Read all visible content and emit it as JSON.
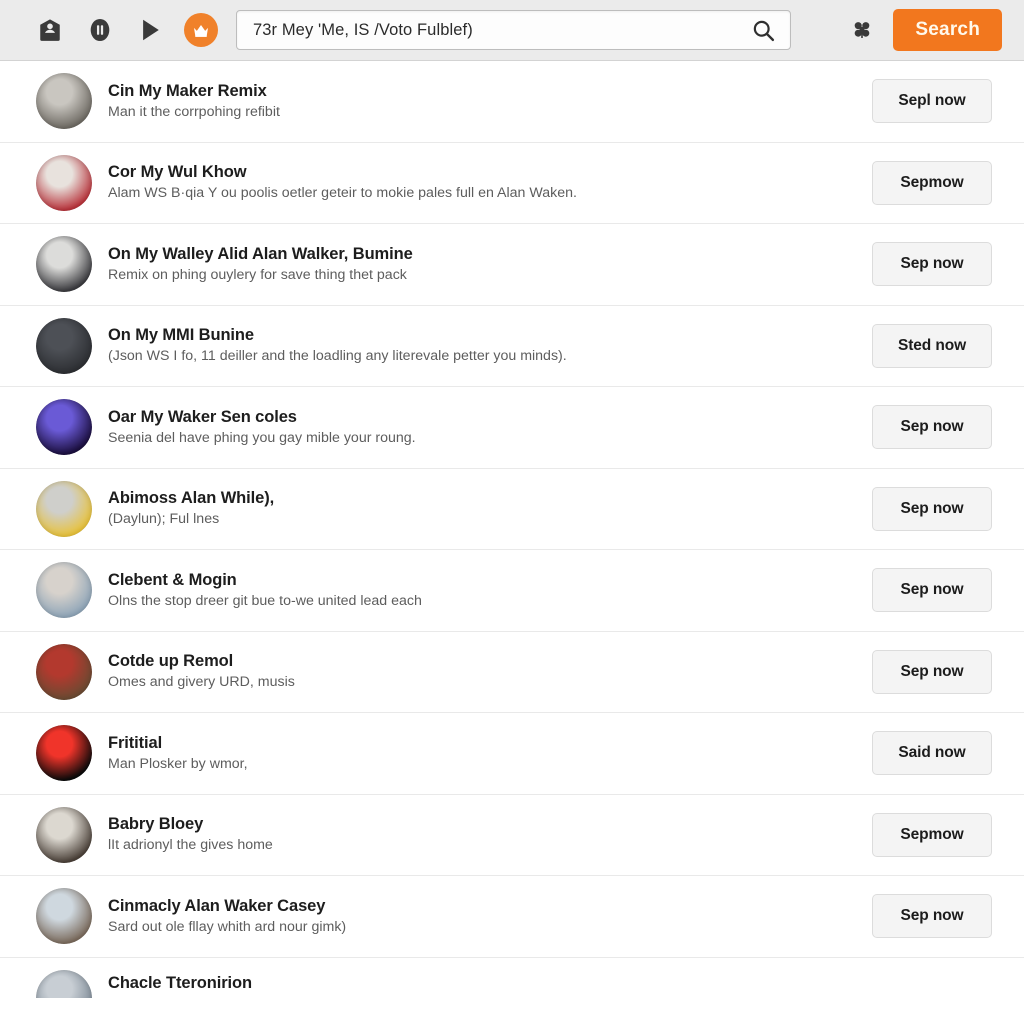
{
  "toolbar": {
    "icons": [
      {
        "name": "inbox-person-icon",
        "glyph": "inbox"
      },
      {
        "name": "pause-circle-icon",
        "glyph": "pause"
      },
      {
        "name": "play-icon",
        "glyph": "play"
      },
      {
        "name": "crown-badge-icon",
        "glyph": "crown"
      }
    ],
    "crown_badge_color": "#f0812a",
    "search": {
      "value": "73r Mey 'Me, IS /Voto Fulblef)",
      "placeholder": "73r Mey 'Me, IS /Voto Fulblef)",
      "icon": "search-icon"
    },
    "clover_icon": "clover-icon",
    "search_button_label": "Search",
    "search_button_color": "#f2771e",
    "background_color": "#ebebeb"
  },
  "list": {
    "rows": [
      {
        "title": "Cin My Maker Remix",
        "subtitle": "Man it the corrpohing refibit",
        "action": "Sepl now",
        "avatar_color_a": "#6e6a63",
        "avatar_color_b": "#c9c6c0"
      },
      {
        "title": "Cor My Wul Khow",
        "subtitle": "Alam WS B·qia Y ou poolis oetler geteir to mokie pales full en Alan Waken.",
        "action": "Sepmow",
        "avatar_color_a": "#b8333b",
        "avatar_color_b": "#e8e2dd"
      },
      {
        "title": "On My Walley Alid Alan Walker, Bumine",
        "subtitle": "Remix on phing ouylery for save thing thet pack",
        "action": "Sep now",
        "avatar_color_a": "#3a3a3e",
        "avatar_color_b": "#dcdcda"
      },
      {
        "title": "On My MMI Bunine",
        "subtitle": "(Json WS I fo, 11 deiller and the loadling any literevale petter you minds).",
        "action": "Sted now",
        "avatar_color_a": "#2d2f33",
        "avatar_color_b": "#4d5056"
      },
      {
        "title": "Oar My Waker Sen coles",
        "subtitle": "Seenia del have phing you gay mible your roung.",
        "action": "Sep now",
        "avatar_color_a": "#1b0f3e",
        "avatar_color_b": "#6a5ad6"
      },
      {
        "title": "Abimoss Alan While),",
        "subtitle": "(Daylun); Ful lnes",
        "action": "Sep now",
        "avatar_color_a": "#e8c23a",
        "avatar_color_b": "#cfcfcb"
      },
      {
        "title": "Clebent & Mogin",
        "subtitle": "Olns the stop dreer git bue to-we united lead each",
        "action": "Sep now",
        "avatar_color_a": "#8fa5b8",
        "avatar_color_b": "#d7d2cc"
      },
      {
        "title": "Cotde up Remol",
        "subtitle": "Omes and givery URD, musis",
        "action": "Sep now",
        "avatar_color_a": "#6b4a32",
        "avatar_color_b": "#b3392e"
      },
      {
        "title": "Frititial",
        "subtitle": "Man Plosker by wmor,",
        "action": "Said now",
        "avatar_color_a": "#0a0a0a",
        "avatar_color_b": "#f0342a"
      },
      {
        "title": "Babry Bloey",
        "subtitle": "lIt adrionyl the gives home",
        "action": "Sepmow",
        "avatar_color_a": "#4a4038",
        "avatar_color_b": "#dcd8d0"
      },
      {
        "title": "Cinmacly Alan Waker Casey",
        "subtitle": "Sard out ole fllay whith ard nour gimk)",
        "action": "Sep now",
        "avatar_color_a": "#7a6a5c",
        "avatar_color_b": "#cfd8df"
      },
      {
        "title": "Chacle Tteronirion",
        "subtitle": "",
        "action": "",
        "avatar_color_a": "#7d8a96",
        "avatar_color_b": "#c8ced4"
      }
    ]
  }
}
